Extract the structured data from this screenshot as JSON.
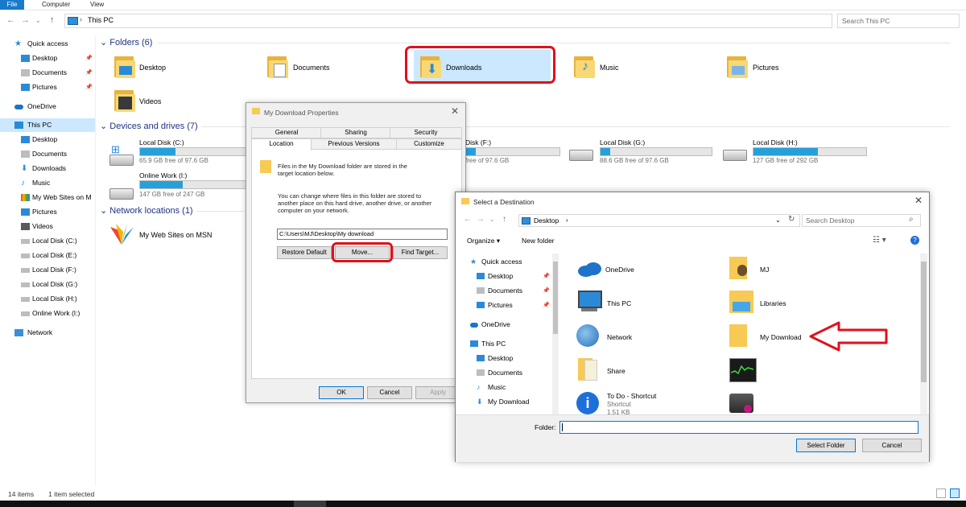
{
  "ribbon": {
    "tabs": [
      "File",
      "Computer",
      "View"
    ]
  },
  "address": {
    "location": "This PC",
    "search_placeholder": "Search This PC"
  },
  "nav": {
    "items": [
      {
        "label": "Quick access",
        "icon": "star-icon"
      },
      {
        "label": "Desktop",
        "icon": "desktop-icon"
      },
      {
        "label": "Documents",
        "icon": "documents-icon"
      },
      {
        "label": "Pictures",
        "icon": "pictures-icon"
      },
      {
        "label": "OneDrive",
        "icon": "cloud-icon"
      },
      {
        "label": "This PC",
        "icon": "computer-icon"
      },
      {
        "label": "Desktop",
        "icon": "desktop-icon"
      },
      {
        "label": "Documents",
        "icon": "documents-icon"
      },
      {
        "label": "Downloads",
        "icon": "download-icon"
      },
      {
        "label": "Music",
        "icon": "music-icon"
      },
      {
        "label": "My Web Sites on M",
        "icon": "msn-icon"
      },
      {
        "label": "Pictures",
        "icon": "pictures-icon"
      },
      {
        "label": "Videos",
        "icon": "videos-icon"
      },
      {
        "label": "Local Disk (C:)",
        "icon": "drive-icon"
      },
      {
        "label": "Local Disk (E:)",
        "icon": "drive-icon"
      },
      {
        "label": "Local Disk (F:)",
        "icon": "drive-icon"
      },
      {
        "label": "Local Disk (G:)",
        "icon": "drive-icon"
      },
      {
        "label": "Local Disk (H:)",
        "icon": "drive-icon"
      },
      {
        "label": "Online Work (I:)",
        "icon": "drive-icon"
      },
      {
        "label": "Network",
        "icon": "network-icon"
      }
    ]
  },
  "sections": {
    "folders": "Folders (6)",
    "devices": "Devices and drives (7)",
    "network": "Network locations (1)"
  },
  "folders": [
    "Desktop",
    "Documents",
    "Downloads",
    "Music",
    "Pictures",
    "Videos"
  ],
  "drives": [
    {
      "name": "Local Disk (C:)",
      "free": "65.9 GB free of 97.6 GB",
      "used_fraction": 0.33
    },
    {
      "name": "Online Work (I:)",
      "free": "147 GB free of 247 GB",
      "used_fraction": 0.4
    },
    {
      "name": "Disk (F:)",
      "free": "free of 97.6 GB",
      "used_fraction": 0.1
    },
    {
      "name": "Local Disk (G:)",
      "free": "88.6 GB free of 97.6 GB",
      "used_fraction": 0.09
    },
    {
      "name": "Local Disk (H:)",
      "free": "127 GB free of 292 GB",
      "used_fraction": 0.57
    }
  ],
  "network_location": "My Web Sites on MSN",
  "status": {
    "items": "14 items",
    "selected": "1 item selected"
  },
  "props": {
    "title": "My Download Properties",
    "tabs_row1": [
      "General",
      "Sharing",
      "Security"
    ],
    "tabs_row2": [
      "Location",
      "Previous Versions",
      "Customize"
    ],
    "desc1a": "Files in the My Download folder are stored in the",
    "desc1b": "target location below.",
    "desc2a": "You can change where files in this folder are stored to",
    "desc2b": "another place on this hard drive, another drive, or another",
    "desc2c": "computer on your network.",
    "path": "C:\\Users\\MJ\\Desktop\\My download",
    "restore": "Restore Default",
    "move": "Move...",
    "find": "Find Target...",
    "ok": "OK",
    "cancel": "Cancel",
    "apply": "Apply"
  },
  "dest": {
    "title": "Select a Destination",
    "location": "Desktop",
    "search_placeholder": "Search Desktop",
    "organize": "Organize ▾",
    "new_folder": "New folder",
    "nav": [
      "Quick access",
      "Desktop",
      "Documents",
      "Pictures",
      "OneDrive",
      "This PC",
      "Desktop",
      "Documents",
      "Music",
      "My Download"
    ],
    "items": [
      {
        "label": "OneDrive",
        "sub": ""
      },
      {
        "label": "MJ",
        "sub": ""
      },
      {
        "label": "This PC",
        "sub": ""
      },
      {
        "label": "Libraries",
        "sub": ""
      },
      {
        "label": "Network",
        "sub": ""
      },
      {
        "label": "My Download",
        "sub": ""
      },
      {
        "label": "Share",
        "sub": ""
      },
      {
        "label": "To Do - Shortcut",
        "sub": "Shortcut",
        "sub2": "1.51 KB"
      }
    ],
    "folder_label": "Folder:",
    "folder_value": "",
    "select": "Select Folder",
    "cancel": "Cancel"
  }
}
